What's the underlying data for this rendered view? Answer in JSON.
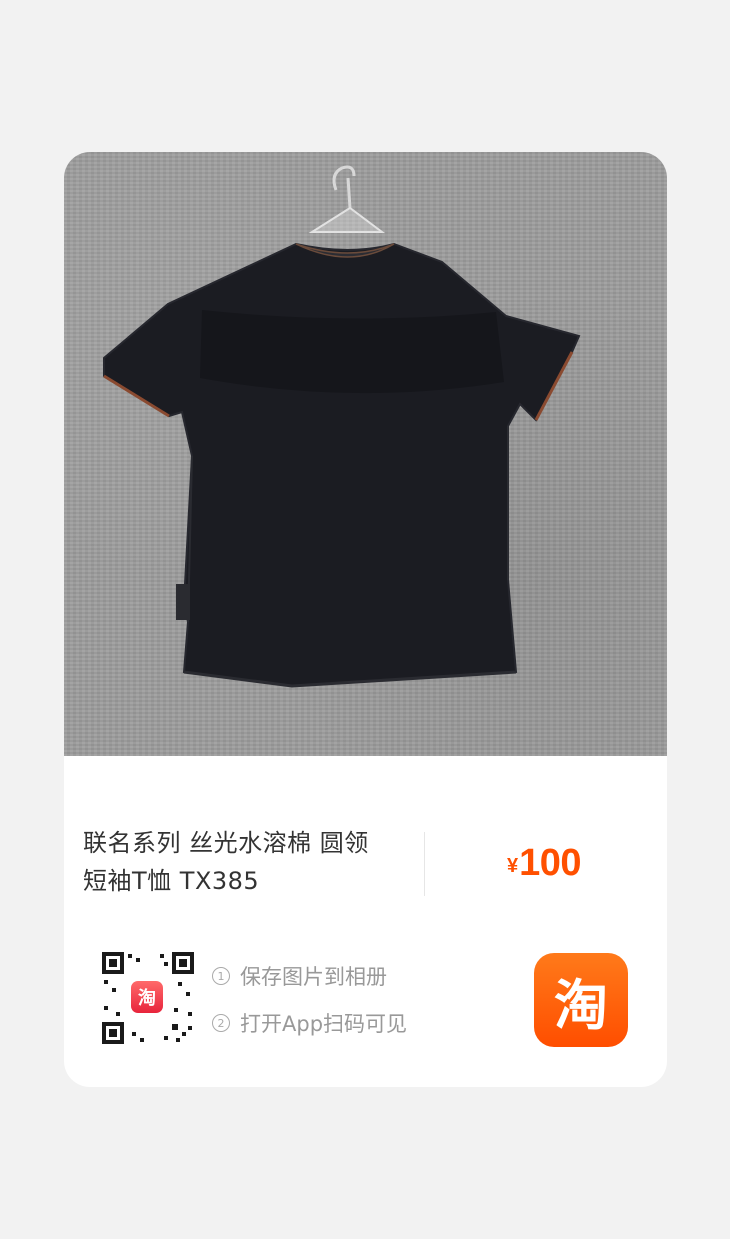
{
  "product": {
    "title_line1": "联名系列 丝光水溶棉 圆领",
    "title_line2": "短袖T恤 TX385",
    "price_symbol": "¥",
    "price_value": "100"
  },
  "share": {
    "step1_num": "1",
    "step1_text": "保存图片到相册",
    "step2_num": "2",
    "step2_text": "打开App扫码可见",
    "qr_logo_char": "淘",
    "app_icon_char": "淘"
  },
  "colors": {
    "price": "#ff5000",
    "app_icon": "#ff5a00",
    "background": "#f2f2f2"
  }
}
